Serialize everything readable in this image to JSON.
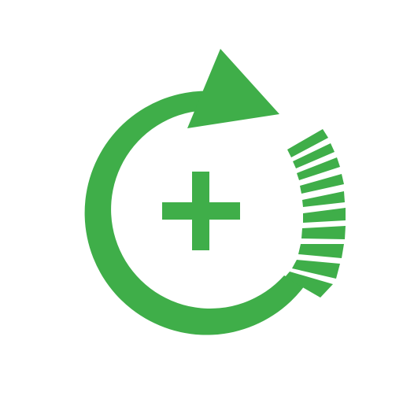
{
  "app_icon": {
    "icon_name": "circular-refresh-add-icon",
    "accent_color": "#3fae49",
    "background_color": "#ffffff"
  }
}
